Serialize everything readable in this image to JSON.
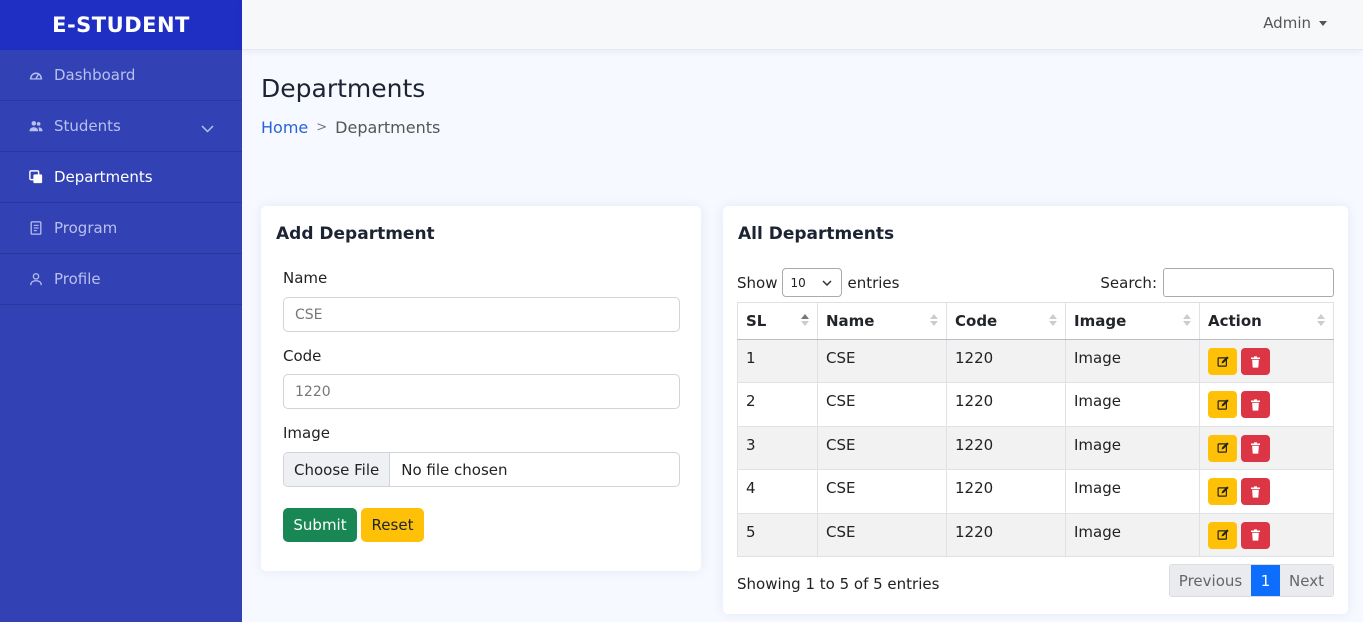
{
  "brand": "E-STUDENT",
  "sidebar": {
    "items": [
      {
        "label": "Dashboard",
        "icon": "speedometer-icon"
      },
      {
        "label": "Students",
        "icon": "people-icon"
      },
      {
        "label": "Departments",
        "icon": "layers-icon",
        "active": true
      },
      {
        "label": "Program",
        "icon": "journal-icon"
      },
      {
        "label": "Profile",
        "icon": "person-icon"
      }
    ]
  },
  "topbar": {
    "user": "Admin"
  },
  "page": {
    "title": "Departments",
    "breadcrumb": {
      "home": "Home",
      "separator": ">",
      "current": "Departments"
    }
  },
  "form": {
    "title": "Add Department",
    "name_label": "Name",
    "name_placeholder": "CSE",
    "code_label": "Code",
    "code_placeholder": "1220",
    "image_label": "Image",
    "file_button": "Choose File",
    "file_status": "No file chosen",
    "submit": "Submit",
    "reset": "Reset"
  },
  "list": {
    "title": "All Departments",
    "show_label": "Show",
    "entries_value": "10",
    "entries_label": "entries",
    "search_label": "Search:",
    "columns": [
      "SL",
      "Name",
      "Code",
      "Image",
      "Action"
    ],
    "rows": [
      {
        "sl": "1",
        "name": "CSE",
        "code": "1220",
        "image": "Image"
      },
      {
        "sl": "2",
        "name": "CSE",
        "code": "1220",
        "image": "Image"
      },
      {
        "sl": "3",
        "name": "CSE",
        "code": "1220",
        "image": "Image"
      },
      {
        "sl": "4",
        "name": "CSE",
        "code": "1220",
        "image": "Image"
      },
      {
        "sl": "5",
        "name": "CSE",
        "code": "1220",
        "image": "Image"
      }
    ],
    "info": "Showing 1 to 5 of 5 entries",
    "pagination": {
      "previous": "Previous",
      "current": "1",
      "next": "Next"
    }
  },
  "colors": {
    "sidebar": "#3242b4",
    "brand_bg": "#1f2fc4",
    "primary": "#0d6efd",
    "success": "#198754",
    "warning": "#ffc107",
    "danger": "#dc3545"
  }
}
